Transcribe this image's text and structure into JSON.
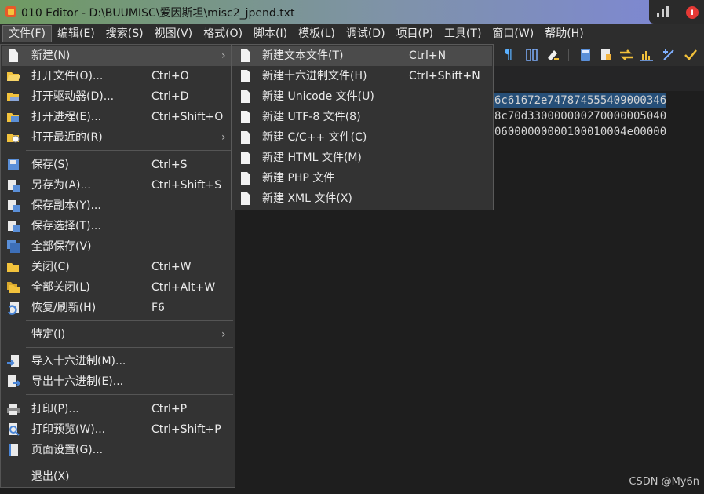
{
  "window": {
    "title": "010 Editor - D:\\BUUMISC\\爱因斯坦\\misc2_jpend.txt"
  },
  "menubar": [
    "文件(F)",
    "编辑(E)",
    "搜索(S)",
    "视图(V)",
    "格式(O)",
    "脚本(I)",
    "模板(L)",
    "调试(D)",
    "项目(P)",
    "工具(T)",
    "窗口(W)",
    "帮助(H)"
  ],
  "file_menu": {
    "items": [
      {
        "label": "新建(N)",
        "shortcut": "",
        "arrow": "›",
        "icon": "new-file-icon"
      },
      {
        "label": "打开文件(O)...",
        "shortcut": "Ctrl+O",
        "icon": "open-folder-icon"
      },
      {
        "label": "打开驱动器(D)...",
        "shortcut": "Ctrl+D",
        "icon": "open-drive-icon"
      },
      {
        "label": "打开进程(E)...",
        "shortcut": "Ctrl+Shift+O",
        "icon": "open-process-icon"
      },
      {
        "label": "打开最近的(R)",
        "shortcut": "",
        "arrow": "›",
        "icon": "open-recent-icon"
      },
      {
        "label": "保存(S)",
        "shortcut": "Ctrl+S",
        "icon": "save-icon"
      },
      {
        "label": "另存为(A)...",
        "shortcut": "Ctrl+Shift+S",
        "icon": "save-as-icon"
      },
      {
        "label": "保存副本(Y)...",
        "shortcut": "",
        "icon": "save-copy-icon"
      },
      {
        "label": "保存选择(T)...",
        "shortcut": "",
        "icon": "save-selection-icon"
      },
      {
        "label": "全部保存(V)",
        "shortcut": "",
        "icon": "save-all-icon"
      },
      {
        "label": "关闭(C)",
        "shortcut": "Ctrl+W",
        "icon": "close-folder-icon"
      },
      {
        "label": "全部关闭(L)",
        "shortcut": "Ctrl+Alt+W",
        "icon": "close-all-icon"
      },
      {
        "label": "恢复/刷新(H)",
        "shortcut": "F6",
        "icon": "revert-icon"
      },
      {
        "label": "特定(I)",
        "shortcut": "",
        "arrow": "›",
        "icon": ""
      },
      {
        "label": "导入十六进制(M)...",
        "shortcut": "",
        "icon": "import-hex-icon"
      },
      {
        "label": "导出十六进制(E)...",
        "shortcut": "",
        "icon": "export-hex-icon"
      },
      {
        "label": "打印(P)...",
        "shortcut": "Ctrl+P",
        "icon": "print-icon"
      },
      {
        "label": "打印预览(W)...",
        "shortcut": "Ctrl+Shift+P",
        "icon": "print-preview-icon"
      },
      {
        "label": "页面设置(G)...",
        "shortcut": "",
        "icon": "page-setup-icon"
      },
      {
        "label": "退出(X)",
        "shortcut": "",
        "icon": ""
      }
    ]
  },
  "new_submenu": {
    "items": [
      {
        "label": "新建文本文件(T)",
        "shortcut": "Ctrl+N"
      },
      {
        "label": "新建十六进制文件(H)",
        "shortcut": "Ctrl+Shift+N"
      },
      {
        "label": "新建 Unicode 文件(U)",
        "shortcut": ""
      },
      {
        "label": "新建 UTF-8 文件(8)",
        "shortcut": ""
      },
      {
        "label": "新建 C/C++ 文件(C)",
        "shortcut": ""
      },
      {
        "label": "新建 HTML 文件(M)",
        "shortcut": ""
      },
      {
        "label": "新建 PHP 文件",
        "shortcut": ""
      },
      {
        "label": "新建 XML 文件(X)",
        "shortcut": ""
      }
    ]
  },
  "editor": {
    "lines": [
      "6c61672e747874555409000346",
      "8c70d330000000270000005040",
      "06000000000100010004e00000"
    ]
  },
  "toolbar": {
    "pilcrow": "¶"
  },
  "overlay": {
    "info": "i"
  },
  "watermark": "CSDN @My6n",
  "colors": {
    "accent_selection": "#264f78",
    "menu_bg": "#333333",
    "highlight": "#4b4b4b"
  }
}
